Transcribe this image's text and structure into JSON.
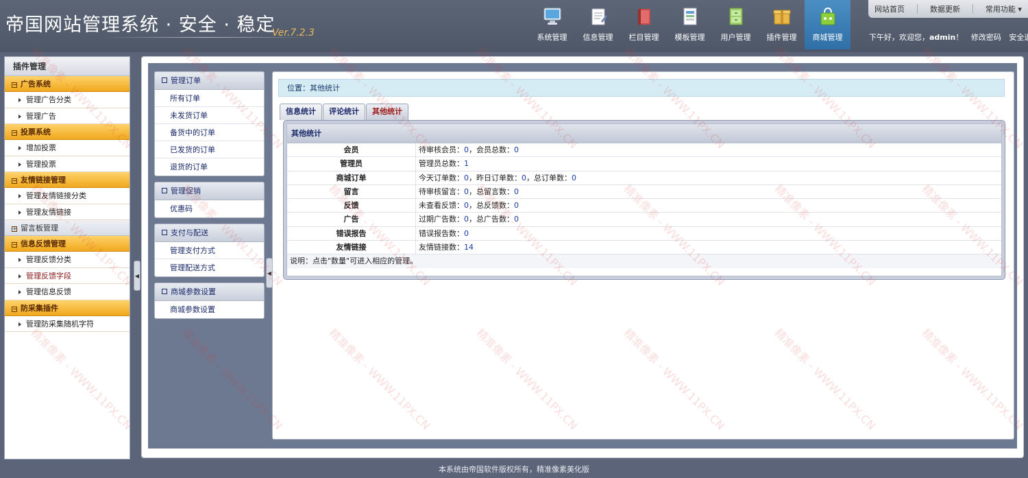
{
  "header": {
    "logo": "帝国网站管理系统 · 安全 · 稳定",
    "version": "Ver.7.2.3",
    "nav": [
      {
        "label": "系统管理",
        "icon": "monitor-icon"
      },
      {
        "label": "信息管理",
        "icon": "notepad-icon"
      },
      {
        "label": "栏目管理",
        "icon": "book-icon"
      },
      {
        "label": "模板管理",
        "icon": "template-icon"
      },
      {
        "label": "用户管理",
        "icon": "cabinet-icon"
      },
      {
        "label": "插件管理",
        "icon": "box-icon"
      },
      {
        "label": "商城管理",
        "icon": "shopping-bag-icon"
      }
    ],
    "top_links": [
      "网站首页",
      "数据更新",
      "常用功能"
    ],
    "welcome_prefix": "下午好，欢迎您，",
    "username": "admin",
    "welcome_suffix": "！",
    "change_password": "修改密码",
    "logout": "安全退出"
  },
  "sidebar": {
    "title": "插件管理",
    "groups": [
      {
        "label": "广告系统",
        "items": [
          "管理广告分类",
          "管理广告"
        ]
      },
      {
        "label": "投票系统",
        "items": [
          "增加投票",
          "管理投票"
        ]
      },
      {
        "label": "友情链接管理",
        "items": [
          "管理友情链接分类",
          "管理友情链接"
        ]
      },
      {
        "label": "留言板管理",
        "items": []
      },
      {
        "label": "信息反馈管理",
        "items": [
          "管理反馈分类",
          "管理反馈字段",
          "管理信息反馈"
        ]
      },
      {
        "label": "防采集插件",
        "items": [
          "管理防采集随机字符"
        ]
      }
    ]
  },
  "submenu": [
    {
      "title": "管理订单",
      "items": [
        "所有订单",
        "未发货订单",
        "备货中的订单",
        "已发货的订单",
        "退货的订单"
      ]
    },
    {
      "title": "管理促销",
      "items": [
        "优惠码"
      ]
    },
    {
      "title": "支付与配送",
      "items": [
        "管理支付方式",
        "管理配送方式"
      ]
    },
    {
      "title": "商城参数设置",
      "items": [
        "商城参数设置"
      ]
    }
  ],
  "breadcrumb": {
    "prefix": "位置：",
    "current": "其他统计"
  },
  "tabs": [
    "信息统计",
    "评论统计",
    "其他统计"
  ],
  "stats": {
    "title": "其他统计",
    "rows": [
      {
        "label": "会员",
        "parts": [
          {
            "t": "待审核会员："
          },
          {
            "n": "0"
          },
          {
            "t": "，会员总数："
          },
          {
            "n": "0"
          }
        ]
      },
      {
        "label": "管理员",
        "parts": [
          {
            "t": "管理员总数："
          },
          {
            "n": "1"
          }
        ]
      },
      {
        "label": "商城订单",
        "parts": [
          {
            "t": "今天订单数："
          },
          {
            "n": "0"
          },
          {
            "t": "，昨日订单数："
          },
          {
            "n": "0"
          },
          {
            "t": "，总订单数："
          },
          {
            "n": "0"
          }
        ]
      },
      {
        "label": "留言",
        "parts": [
          {
            "t": "待审核留言："
          },
          {
            "n": "0"
          },
          {
            "t": "，总留言数："
          },
          {
            "n": "0"
          }
        ]
      },
      {
        "label": "反馈",
        "parts": [
          {
            "t": "未查看反馈："
          },
          {
            "n": "0"
          },
          {
            "t": "，总反馈数："
          },
          {
            "n": "0"
          }
        ]
      },
      {
        "label": "广告",
        "parts": [
          {
            "t": "过期广告数："
          },
          {
            "n": "0"
          },
          {
            "t": "，总广告数："
          },
          {
            "n": "0"
          }
        ]
      },
      {
        "label": "错误报告",
        "parts": [
          {
            "t": "错误报告数："
          },
          {
            "n": "0"
          }
        ]
      },
      {
        "label": "友情链接",
        "parts": [
          {
            "t": "友情链接数："
          },
          {
            "n": "14"
          }
        ]
      }
    ],
    "note": "说明：点击\"数量\"可进入相应的管理。"
  },
  "footer": "本系统由帝国软件版权所有，精准像素美化版",
  "watermark": "精准像素 - WWW.11PX.CN",
  "colors": {
    "accent": "#f0a81e",
    "header": "#5b6478",
    "active_tab": "#9a1a1a",
    "link": "#1a3aa0"
  }
}
